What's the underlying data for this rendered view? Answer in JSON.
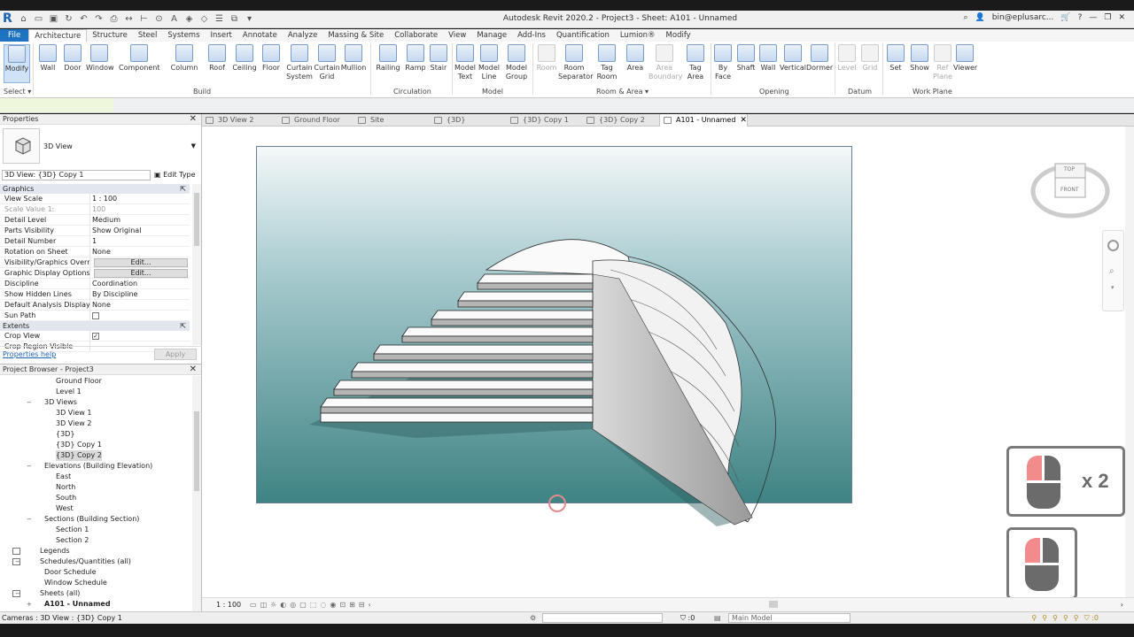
{
  "titlebar": {
    "window_title": "Autodesk Revit 2020.2 - Project3 - Sheet: A101 - Unnamed",
    "user": "bin@eplusarc...",
    "help": "?"
  },
  "ribbon_tabs": [
    "File",
    "Architecture",
    "Structure",
    "Steel",
    "Systems",
    "Insert",
    "Annotate",
    "Analyze",
    "Massing & Site",
    "Collaborate",
    "View",
    "Manage",
    "Add-Ins",
    "Quantification",
    "Lumion®",
    "Modify"
  ],
  "ribbon": {
    "select_label": "Select",
    "modify_label": "Modify",
    "build": {
      "label": "Build",
      "items": [
        "Wall",
        "Door",
        "Window",
        "Component",
        "Column",
        "Roof",
        "Ceiling",
        "Floor",
        "Curtain System",
        "Curtain Grid",
        "Mullion"
      ]
    },
    "circulation": {
      "label": "Circulation",
      "items": [
        "Railing",
        "Ramp",
        "Stair"
      ]
    },
    "model": {
      "label": "Model",
      "items": [
        "Model Text",
        "Model Line",
        "Model Group"
      ]
    },
    "room_area": {
      "label": "Room & Area",
      "items": [
        "Room",
        "Room Separator",
        "Tag Room",
        "Area",
        "Area Boundary",
        "Tag Area"
      ]
    },
    "opening": {
      "label": "Opening",
      "items": [
        "By Face",
        "Shaft",
        "Wall",
        "Vertical",
        "Dormer"
      ]
    },
    "datum": {
      "label": "Datum",
      "items": [
        "Level",
        "Grid"
      ]
    },
    "workplane": {
      "label": "Work Plane",
      "items": [
        "Set",
        "Show",
        "Ref Plane",
        "Viewer"
      ]
    }
  },
  "properties": {
    "title": "Properties",
    "type_name": "3D View",
    "instance_selector": "3D View: {3D} Copy 1",
    "edit_type": "Edit Type",
    "groups": [
      {
        "name": "Graphics",
        "rows": [
          {
            "k": "View Scale",
            "v": "1 : 100"
          },
          {
            "k": "Scale Value    1:",
            "v": "100",
            "gray": true
          },
          {
            "k": "Detail Level",
            "v": "Medium"
          },
          {
            "k": "Parts Visibility",
            "v": "Show Original"
          },
          {
            "k": "Detail Number",
            "v": "1"
          },
          {
            "k": "Rotation on Sheet",
            "v": "None"
          },
          {
            "k": "Visibility/Graphics Overri...",
            "v": "Edit...",
            "button": true
          },
          {
            "k": "Graphic Display Options",
            "v": "Edit...",
            "button": true
          },
          {
            "k": "Discipline",
            "v": "Coordination"
          },
          {
            "k": "Show Hidden Lines",
            "v": "By Discipline"
          },
          {
            "k": "Default Analysis Display S...",
            "v": "None"
          },
          {
            "k": "Sun Path",
            "v": "",
            "check": false
          }
        ]
      },
      {
        "name": "Extents",
        "rows": [
          {
            "k": "Crop View",
            "v": "",
            "check": true
          },
          {
            "k": "Crop Region Visible",
            "v": ""
          }
        ]
      }
    ],
    "help_link": "Properties help",
    "apply": "Apply"
  },
  "browser": {
    "title": "Project Browser - Project3",
    "nodes": [
      {
        "label": "Ground Floor",
        "level": 3
      },
      {
        "label": "Level 1",
        "level": 3
      },
      {
        "label": "3D Views",
        "level": 2,
        "toggle": "−"
      },
      {
        "label": "3D View 1",
        "level": 3
      },
      {
        "label": "3D View 2",
        "level": 3
      },
      {
        "label": "{3D}",
        "level": 3
      },
      {
        "label": "{3D} Copy 1",
        "level": 3
      },
      {
        "label": "{3D} Copy 2",
        "level": 3,
        "selected": true
      },
      {
        "label": "Elevations (Building Elevation)",
        "level": 2,
        "toggle": "−"
      },
      {
        "label": "East",
        "level": 3
      },
      {
        "label": "North",
        "level": 3
      },
      {
        "label": "South",
        "level": 3
      },
      {
        "label": "West",
        "level": 3
      },
      {
        "label": "Sections (Building Section)",
        "level": 2,
        "toggle": "−"
      },
      {
        "label": "Section 1",
        "level": 3
      },
      {
        "label": "Section 2",
        "level": 3
      },
      {
        "label": "Legends",
        "level": 1,
        "icon": true
      },
      {
        "label": "Schedules/Quantities (all)",
        "level": 1,
        "toggle": "−",
        "icon": true
      },
      {
        "label": "Door Schedule",
        "level": 2
      },
      {
        "label": "Window Schedule",
        "level": 2
      },
      {
        "label": "Sheets (all)",
        "level": 1,
        "toggle": "−",
        "icon": true
      },
      {
        "label": "A101 - Unnamed",
        "level": 2,
        "toggle": "+",
        "bold": true
      }
    ]
  },
  "doc_tabs": [
    {
      "label": "3D View 2"
    },
    {
      "label": "Ground Floor"
    },
    {
      "label": "Site"
    },
    {
      "label": "{3D}"
    },
    {
      "label": "{3D} Copy 1"
    },
    {
      "label": "{3D} Copy 2"
    },
    {
      "label": "A101 - Unnamed",
      "active": true
    }
  ],
  "viewcube": {
    "top": "TOP",
    "front": "FRONT"
  },
  "view_control": {
    "scale": "1 : 100"
  },
  "overlay": {
    "double_click": "x 2"
  },
  "statusbar": {
    "message": "Cameras : 3D View : {3D} Copy 1",
    "selection_count": ":0",
    "model": "Main Model",
    "right_count": ":0"
  },
  "colors": {
    "accent": "#1e72c2",
    "mouse_button": "#f28b8b",
    "sky_top": "#f4f8f9",
    "sky_bottom": "#3f8384"
  }
}
